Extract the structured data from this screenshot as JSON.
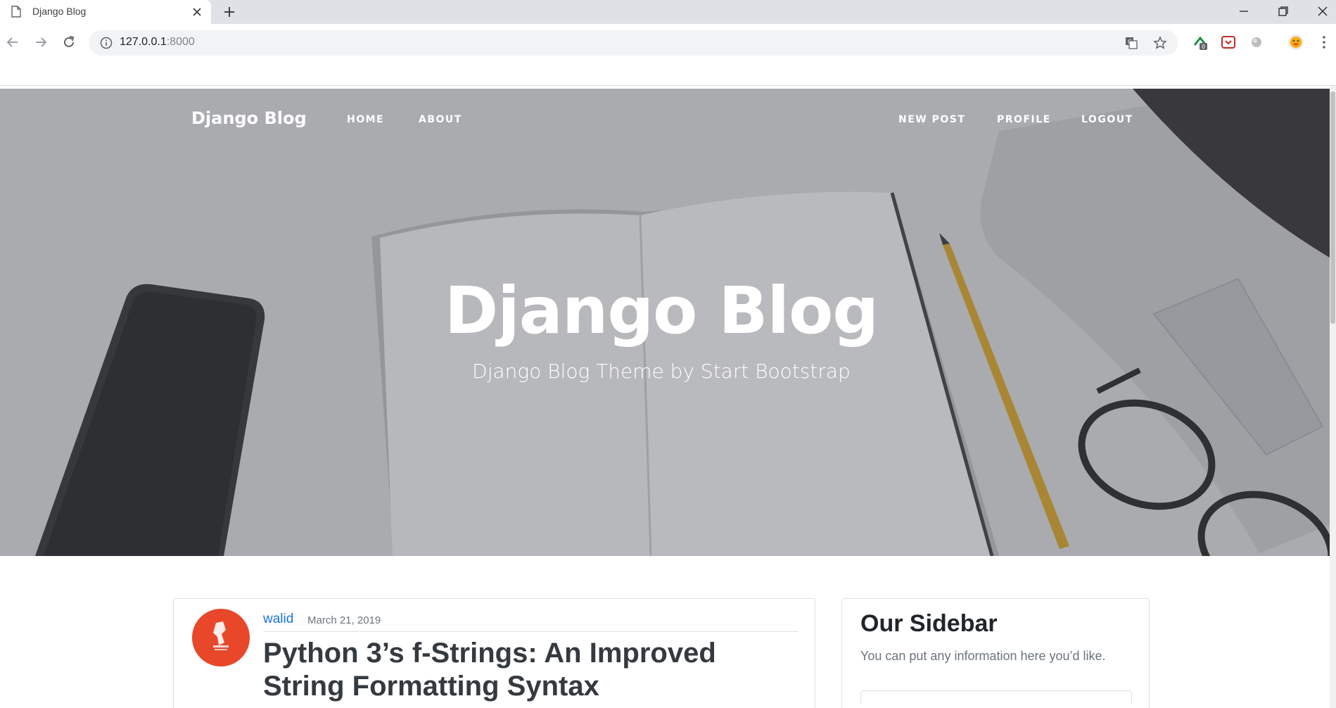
{
  "browser": {
    "tab_title": "Django Blog",
    "url_host": "127.0.0.1",
    "url_port": ":8000",
    "extension_badge": "0"
  },
  "site": {
    "brand": "Django Blog",
    "nav_left": [
      "Home",
      "About"
    ],
    "nav_right": [
      "New Post",
      "Profile",
      "Logout"
    ]
  },
  "hero": {
    "title": "Django Blog",
    "subtitle": "Django Blog Theme by Start Bootstrap"
  },
  "post": {
    "author": "walid",
    "date": "March 21, 2019",
    "title": "Python 3’s f-Strings: An Improved String Formatting Syntax"
  },
  "sidebar": {
    "title": "Our Sidebar",
    "text": "You can put any information here you’d like."
  },
  "colors": {
    "link": "#1a73e8",
    "avatar_bg": "#e8472a"
  }
}
